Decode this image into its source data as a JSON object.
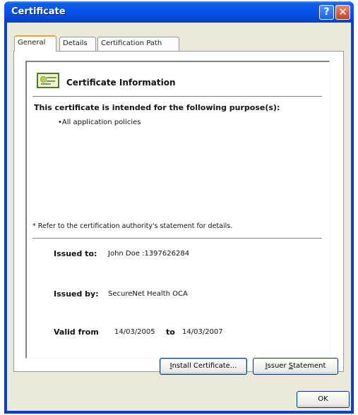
{
  "window": {
    "title": "Certificate",
    "help_icon": "?",
    "close_icon": "✕"
  },
  "tabs": [
    {
      "label": "General",
      "active": true
    },
    {
      "label": "Details",
      "active": false
    },
    {
      "label": "Certification Path",
      "active": false
    }
  ],
  "info": {
    "heading": "Certificate Information",
    "purpose_title": "This certificate is intended for the following purpose(s):",
    "purposes": [
      "•All application policies"
    ],
    "refer_note": "* Refer to the certification authority's statement for details."
  },
  "issued_to": {
    "label": "Issued to:",
    "value": "John Doe :1397626284"
  },
  "issued_by": {
    "label": "Issued by:",
    "value": "SecureNet Health OCA"
  },
  "validity": {
    "from_label": "Valid from",
    "from": "14/03/2005",
    "to_label": "to",
    "to": "14/03/2007"
  },
  "buttons": {
    "install_first": "I",
    "install_rest": "nstall Certificate...",
    "issuer_first": "I",
    "issuer_mid": "ssuer ",
    "issuer_u": "S",
    "issuer_rest": "tatement",
    "ok": "OK"
  }
}
